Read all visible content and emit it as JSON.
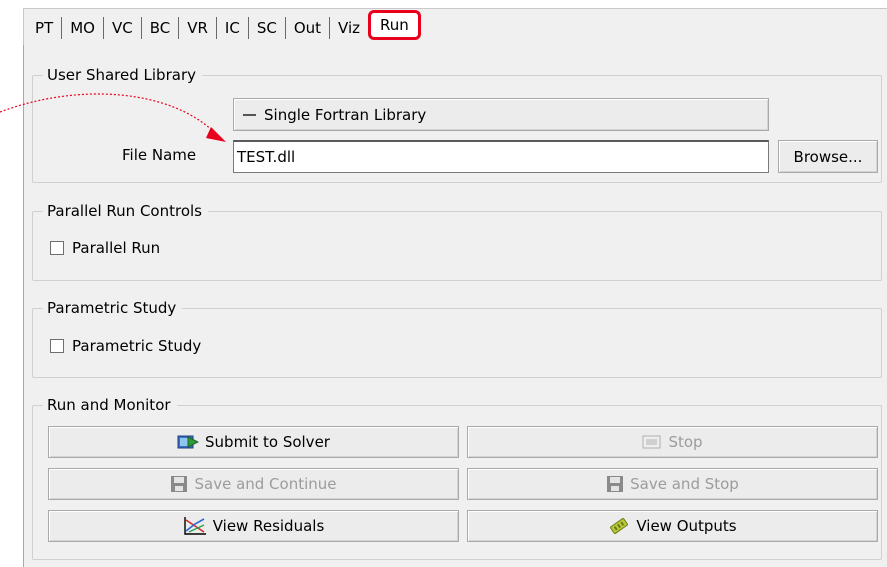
{
  "tabs": [
    {
      "label": "PT",
      "active": false
    },
    {
      "label": "MO",
      "active": false
    },
    {
      "label": "VC",
      "active": false
    },
    {
      "label": "BC",
      "active": false
    },
    {
      "label": "VR",
      "active": false
    },
    {
      "label": "IC",
      "active": false
    },
    {
      "label": "SC",
      "active": false
    },
    {
      "label": "Out",
      "active": false
    },
    {
      "label": "Viz",
      "active": false
    },
    {
      "label": "Run",
      "active": true
    }
  ],
  "user_shared_library": {
    "title": "User Shared Library",
    "library_type": "Single Fortran Library",
    "file_name_label": "File Name",
    "file_name_value": "TEST.dll",
    "browse_label": "Browse..."
  },
  "parallel_run": {
    "title": "Parallel Run Controls",
    "checkbox_label": "Parallel Run",
    "checked": false
  },
  "parametric_study": {
    "title": "Parametric Study",
    "checkbox_label": "Parametric Study",
    "checked": false
  },
  "run_monitor": {
    "title": "Run and Monitor",
    "submit_label": "Submit to Solver",
    "stop_label": "Stop",
    "save_continue_label": "Save and Continue",
    "save_stop_label": "Save and Stop",
    "residuals_label": "View Residuals",
    "outputs_label": "View Outputs",
    "stop_enabled": false,
    "save_continue_enabled": false,
    "save_stop_enabled": false
  },
  "icons": {
    "submit": "solver-submit-icon",
    "stop": "stop-icon",
    "save": "floppy-disk-icon",
    "residuals": "residuals-chart-icon",
    "outputs": "outputs-icon"
  },
  "colors": {
    "highlight": "#e8001c",
    "annotation_arrow": "#e8001c",
    "panel_bg": "#f0f0f0",
    "disabled_text": "#9c9c9c"
  }
}
